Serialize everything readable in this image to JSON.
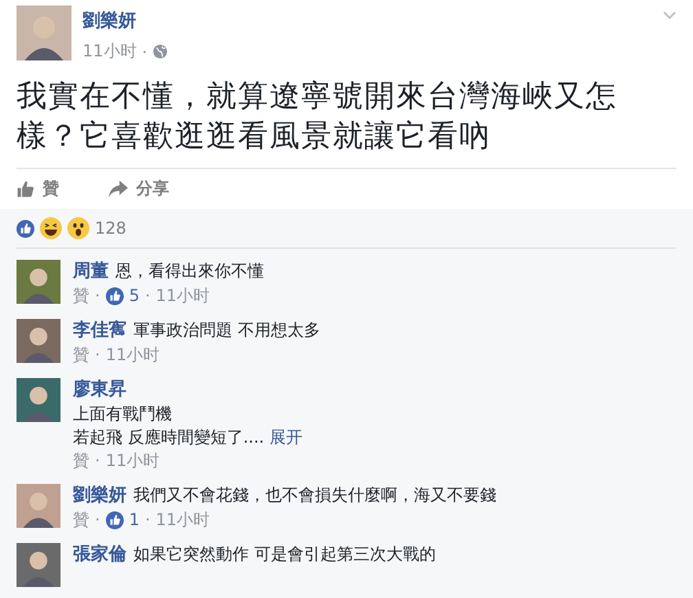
{
  "post": {
    "author": "劉樂妍",
    "time": "11小时",
    "separator": "·",
    "text": "我實在不懂，就算遼寧號開來台灣海峽又怎樣？它喜歡逛逛看風景就讓它看吶",
    "actions": [
      {
        "kind": "like",
        "label": "贊"
      },
      {
        "kind": "share",
        "label": "分享"
      }
    ]
  },
  "reactions": {
    "count": "128"
  },
  "comments": [
    {
      "author": "周董",
      "lines": [
        "恩，看得出來你不懂"
      ],
      "like_label": "贊",
      "separator": "·",
      "likes": "5",
      "separator_2": "·",
      "time": "11小时"
    },
    {
      "author": "李佳寯",
      "lines": [
        "軍事政治問題 不用想太多"
      ],
      "like_label": "贊",
      "separator": "·",
      "time": "11小时"
    },
    {
      "author": "廖東昇",
      "lines": [
        "上面有戰鬥機",
        "若起飛 反應時間變短了...."
      ],
      "more": "展开",
      "like_label": "贊",
      "separator": "·",
      "time": "11小时"
    },
    {
      "author": "劉樂妍",
      "lines": [
        "我們又不會花錢，也不會損失什麼啊，海又不要錢"
      ],
      "like_label": "贊",
      "separator": "·",
      "likes": "1",
      "separator_2": "·",
      "time": "11小时"
    },
    {
      "author": "張家倫",
      "lines": [
        "如果它突然動作 可是會引起第三次大戰的"
      ]
    }
  ]
}
